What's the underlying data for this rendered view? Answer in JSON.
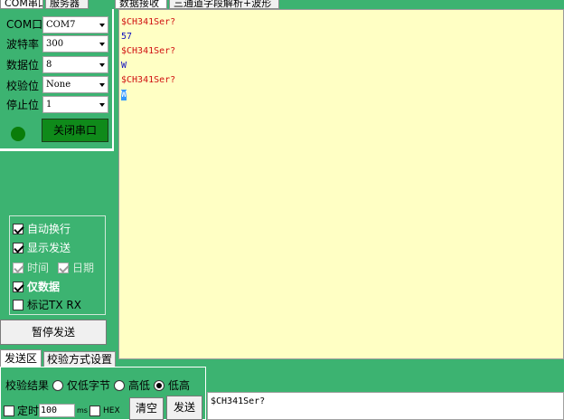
{
  "top_tabs_left": [
    {
      "label": "COM串口",
      "active": true
    },
    {
      "label": "服务器",
      "active": false
    }
  ],
  "top_tabs_right": [
    {
      "label": "数据接收",
      "active": true
    },
    {
      "label": "三通道字段解析+波形",
      "active": false
    }
  ],
  "serial": {
    "com_label": "COM口",
    "com_value": "COM7",
    "baud_label": "波特率",
    "baud_value": "300",
    "databits_label": "数据位",
    "databits_value": "8",
    "parity_label": "校验位",
    "parity_value": "None",
    "stopbits_label": "停止位",
    "stopbits_value": "1",
    "status_color": "#008000",
    "close_button": "关闭串口"
  },
  "options": {
    "auto_wrap": {
      "label": "自动换行",
      "checked": true
    },
    "show_send": {
      "label": "显示发送",
      "checked": true
    },
    "time": {
      "label": "时间",
      "checked": true,
      "disabled": true
    },
    "date": {
      "label": "日期",
      "checked": true,
      "disabled": true
    },
    "data_only": {
      "label": "仅数据",
      "checked": true
    },
    "mark_txrx": {
      "label": "标记TX RX",
      "checked": false
    }
  },
  "pause_button": "暂停发送",
  "bottom_tabs": [
    {
      "label": "发送区",
      "active": true
    },
    {
      "label": "校验方式设置",
      "active": false
    }
  ],
  "checksum": {
    "label": "校验结果",
    "options": [
      {
        "label": "仅低字节",
        "selected": false
      },
      {
        "label": "高低",
        "selected": false
      },
      {
        "label": "低高",
        "selected": true
      }
    ]
  },
  "send_controls": {
    "timer_label": "定时",
    "timer_value": "100",
    "timer_unit": "ms",
    "hex_label": "HEX",
    "clear_button": "清空",
    "send_button": "发送"
  },
  "receive_lines": [
    {
      "text": "$CH341Ser?",
      "color": "red"
    },
    {
      "text": "57",
      "color": "blue"
    },
    {
      "text": "$CH341Ser?",
      "color": "red"
    },
    {
      "text": "W",
      "color": "blue"
    },
    {
      "text": "$CH341Ser?",
      "color": "red"
    },
    {
      "text": "W",
      "color": "selected"
    }
  ],
  "send_text": "$CH341Ser?"
}
